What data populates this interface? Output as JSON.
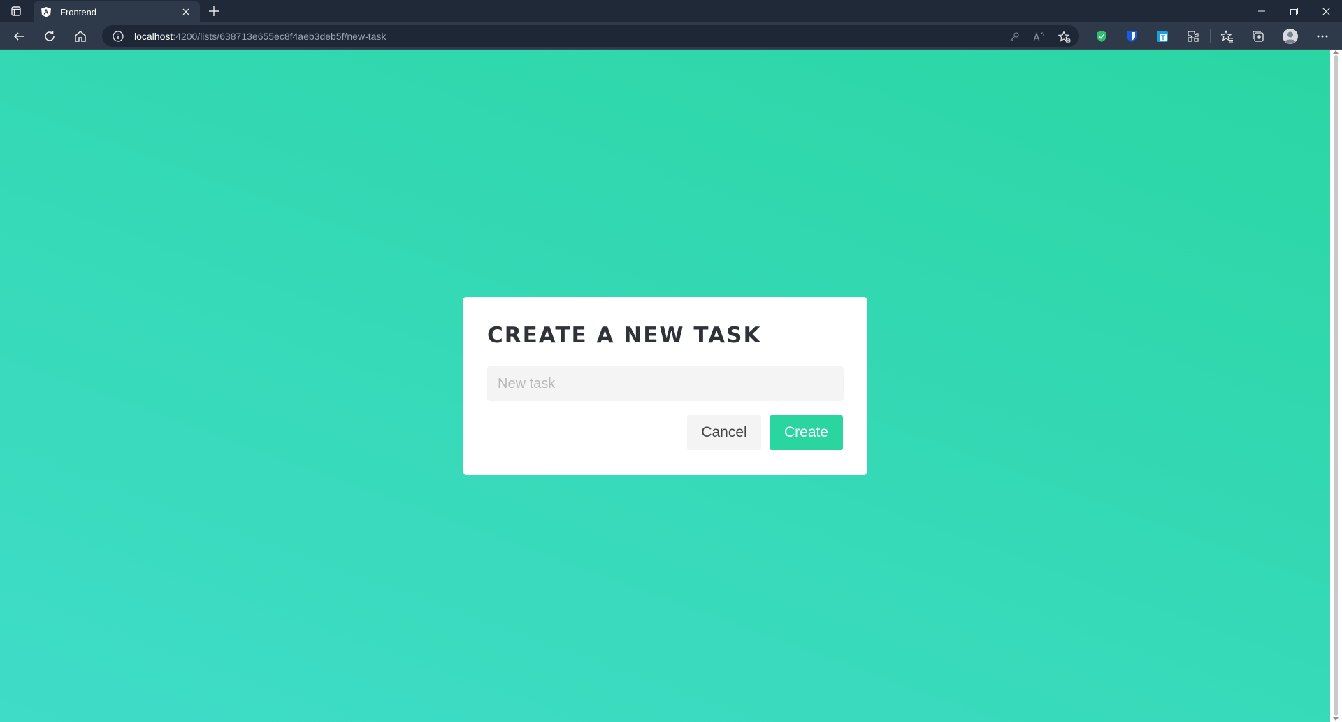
{
  "browser": {
    "tab_title": "Frontend",
    "url_host": "localhost",
    "url_path": ":4200/lists/638713e655ec8f4aeb3deb5f/new-task"
  },
  "dialog": {
    "title": "CREATE A NEW TASK",
    "input_placeholder": "New task",
    "input_value": "",
    "cancel_label": "Cancel",
    "create_label": "Create"
  },
  "colors": {
    "accent": "#2bd5a0",
    "background_top": "#2bd6a3",
    "background_bottom": "#3fdcc8"
  }
}
